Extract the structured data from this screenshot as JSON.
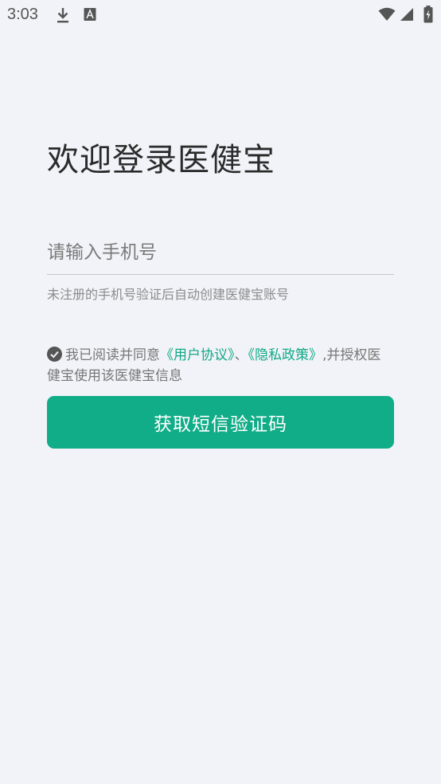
{
  "status_bar": {
    "time": "3:03",
    "icons": [
      "download-icon",
      "font-notification-icon",
      "wifi-icon",
      "signal-icon",
      "battery-charging-icon"
    ]
  },
  "login": {
    "title": "欢迎登录医健宝",
    "phone_placeholder": "请输入手机号",
    "phone_value": "",
    "hint": "未注册的手机号验证后自动创建医健宝账号",
    "agreement": {
      "checked": true,
      "prefix": "我已阅读并同意",
      "user_agreement": "《用户协议》",
      "separator": "、",
      "privacy_policy": "《隐私政策》",
      "suffix": ",并授权医健宝使用该医健宝信息"
    },
    "submit_label": "获取短信验证码"
  },
  "colors": {
    "accent": "#11ad88",
    "link": "#11a886",
    "background": "#f2f3f8"
  }
}
